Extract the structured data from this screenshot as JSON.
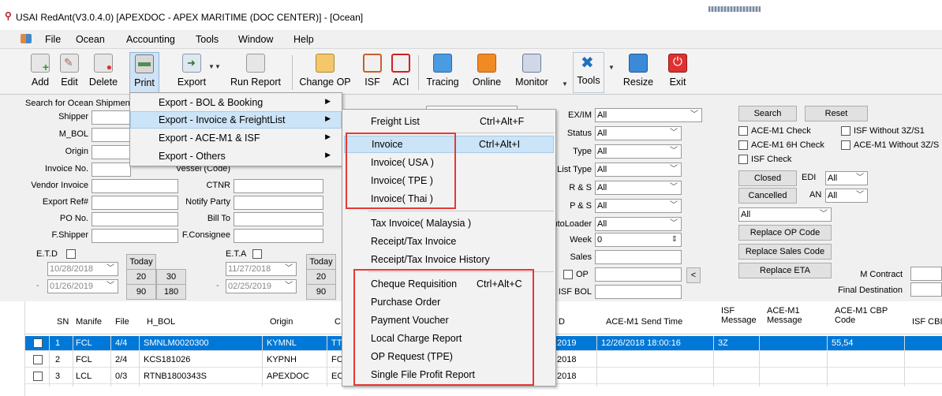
{
  "window": {
    "title": "USAI RedAnt(V3.0.4.0) [APEXDOC - APEX MARITIME (DOC CENTER)] - [Ocean]"
  },
  "menubar": [
    "File",
    "Ocean",
    "Accounting",
    "Tools",
    "Window",
    "Help"
  ],
  "toolbar": {
    "add": "Add",
    "edit": "Edit",
    "delete": "Delete",
    "print": "Print",
    "export": "Export",
    "run_report": "Run Report",
    "change_op": "Change OP",
    "isf": "ISF",
    "aci": "ACI",
    "tracing": "Tracing",
    "online": "Online",
    "monitor": "Monitor",
    "tools": "Tools",
    "resize": "Resize",
    "exit": "Exit"
  },
  "search": {
    "title": "Search for Ocean Shipment",
    "shipper": "Shipper",
    "m_bol": "M_BOL",
    "origin": "Origin",
    "invoice_no": "Invoice No.",
    "vendor_invoice": "Vendor Invoice",
    "export_ref": "Export Ref#",
    "po_no": "PO No.",
    "f_shipper": "F.Shipper",
    "vessel": "Vessel (Code)",
    "ctnr": "CTNR",
    "notify_party": "Notify Party",
    "bill_to": "Bill To",
    "f_consignee": "F.Consignee",
    "etd": "E.T.D",
    "eta": "E.T.A",
    "today": "Today",
    "etd_from": "10/28/2018",
    "etd_to": "01/26/2019",
    "eta_from": "11/27/2018",
    "eta_to": "02/25/2019",
    "d20": "20",
    "d30": "30",
    "d90": "90",
    "d180": "180"
  },
  "filters": {
    "ex_im": "EX/IM",
    "status": "Status",
    "type": "Type",
    "list_type": "List Type",
    "rs": "R & S",
    "ps": "P & S",
    "autoloader": "AutoLoader",
    "week": "Week",
    "sales": "Sales",
    "op": "OP",
    "isf_bol": "ISF BOL",
    "all": "All",
    "week_value": "0"
  },
  "actions": {
    "search": "Search",
    "reset": "Reset",
    "ace_m1_check": "ACE-M1 Check",
    "isf_without": "ISF Without 3Z/S1",
    "ace_m1_6h": "ACE-M1 6H Check",
    "ace_m1_without": "ACE-M1 Without 3Z/S",
    "isf_check": "ISF Check",
    "closed": "Closed",
    "edi": "EDI",
    "cancelled": "Cancelled",
    "an": "AN",
    "all": "All",
    "replace_op": "Replace OP Code",
    "replace_sales": "Replace Sales Code",
    "replace_eta": "Replace ETA",
    "m_contract": "M Contract",
    "final_destination": "Final Destination"
  },
  "grid": {
    "headers": {
      "sn": "SN",
      "manifest": "Manife",
      "file": "File",
      "hbol": "H_BOL",
      "origin": "Origin",
      "c": "C",
      "d": "D",
      "ace_send": "ACE-M1 Send Time",
      "isf_msg": "ISF\nMessage",
      "ace_msg": "ACE-M1\nMessage",
      "ace_cbp": "ACE-M1 CBP\nCode",
      "isf_cbp": "ISF CBI"
    },
    "rows": [
      {
        "sn": "1",
        "manifest": "FCL",
        "file": "4/4",
        "hbol": "SMNLM0020300",
        "origin": "KYMNL",
        "c": "TT",
        "d": "2019",
        "ace_send": "12/26/2018 18:00:16",
        "isf_msg": "3Z",
        "ace_cbp": "55,54"
      },
      {
        "sn": "2",
        "manifest": "FCL",
        "file": "2/4",
        "hbol": "KCS181026",
        "origin": "KYPNH",
        "c": "FC",
        "d": "2018",
        "ace_send": "",
        "isf_msg": "",
        "ace_cbp": ""
      },
      {
        "sn": "3",
        "manifest": "LCL",
        "file": "0/3",
        "hbol": "RTNB1800343S",
        "origin": "APEXDOC",
        "c": "EC",
        "d": "2018",
        "ace_send": "",
        "isf_msg": "",
        "ace_cbp": ""
      }
    ]
  },
  "print_menu": {
    "items": [
      "Export - BOL & Booking",
      "Export - Invoice & FreightList",
      "Export - ACE-M1 & ISF",
      "Export - Others"
    ]
  },
  "submenu": {
    "freight_list": "Freight List",
    "freight_list_sc": "Ctrl+Alt+F",
    "invoice": "Invoice",
    "invoice_sc": "Ctrl+Alt+I",
    "invoice_usa": "Invoice( USA )",
    "invoice_tpe": "Invoice( TPE )",
    "invoice_thai": "Invoice( Thai )",
    "tax_invoice_my": "Tax Invoice( Malaysia )",
    "receipt_tax": "Receipt/Tax Invoice",
    "receipt_tax_history": "Receipt/Tax Invoice History",
    "cheque": "Cheque Requisition",
    "cheque_sc": "Ctrl+Alt+C",
    "purchase_order": "Purchase Order",
    "payment_voucher": "Payment Voucher",
    "local_charge": "Local Charge Report",
    "op_request": "OP Request (TPE)",
    "single_file": "Single File Profit Report"
  }
}
